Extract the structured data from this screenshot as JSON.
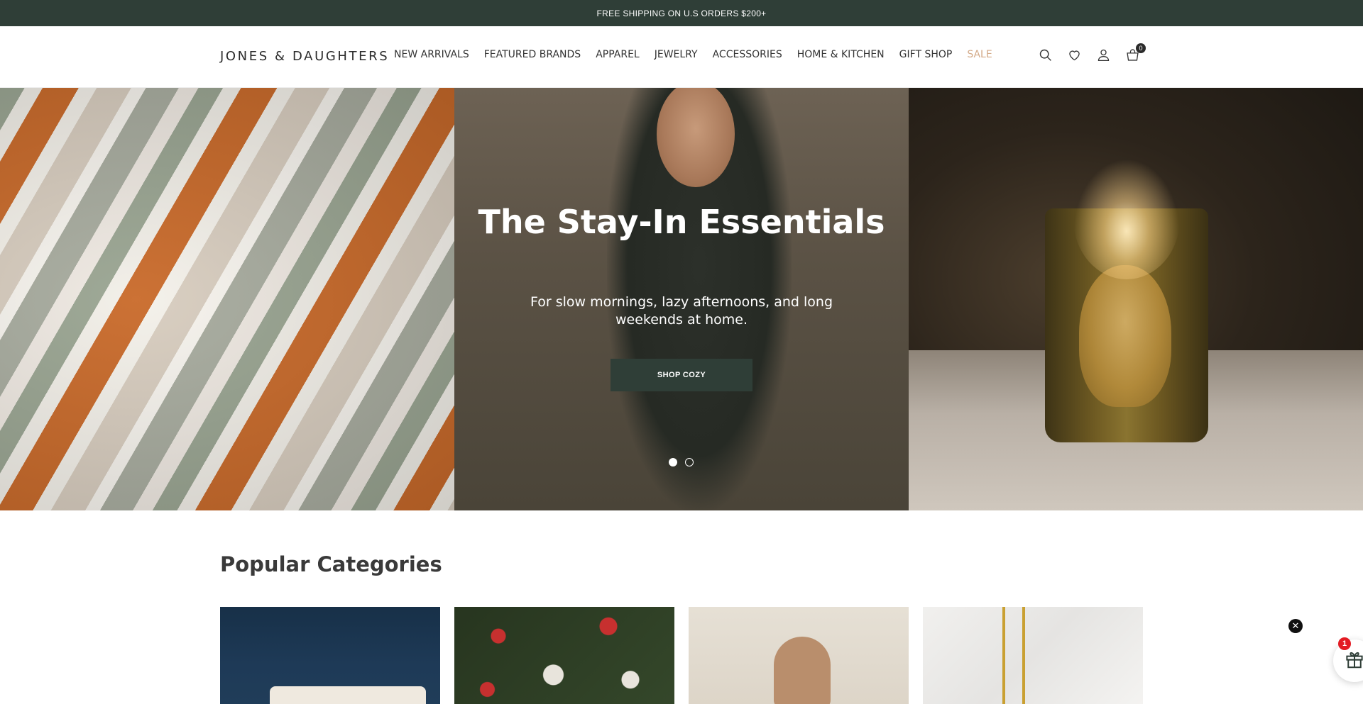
{
  "announcement": {
    "text": "FREE SHIPPING ON U.S ORDERS $200+"
  },
  "header": {
    "logo": "JONES & DAUGHTERS",
    "nav": [
      {
        "label": "NEW ARRIVALS"
      },
      {
        "label": "FEATURED BRANDS"
      },
      {
        "label": "APPAREL"
      },
      {
        "label": "JEWELRY"
      },
      {
        "label": "ACCESSORIES"
      },
      {
        "label": "HOME & KITCHEN"
      },
      {
        "label": "GIFT SHOP"
      },
      {
        "label": "SALE"
      }
    ],
    "sale_color": "#d3aa88",
    "icons": [
      "search-icon",
      "wishlist-icon",
      "account-icon",
      "cart-icon"
    ],
    "cart_count": "0"
  },
  "hero": {
    "title": "The Stay-In Essentials",
    "subtitle": "For slow mornings, lazy afternoons, and long weekends at home.",
    "button": "SHOP COZY",
    "slides_total": 2,
    "active_slide": 1
  },
  "popular": {
    "title": "Popular Categories"
  },
  "gift_widget": {
    "badge": "1",
    "close_glyph": "✕"
  },
  "colors": {
    "brand_dark_green": "#2f3e37",
    "sale": "#d3aa88",
    "badge_red": "#e31b23"
  }
}
